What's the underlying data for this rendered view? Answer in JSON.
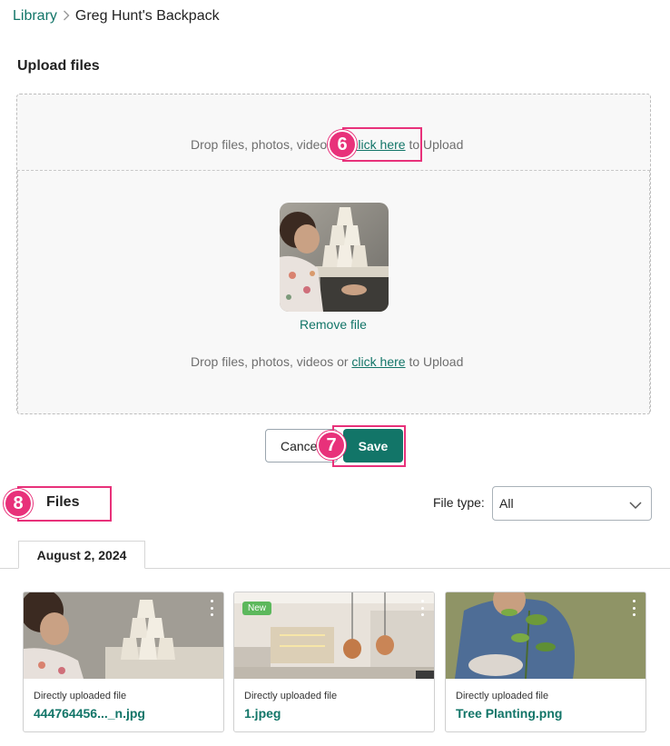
{
  "breadcrumb": {
    "root": "Library",
    "current": "Greg Hunt's Backpack"
  },
  "upload": {
    "title": "Upload files",
    "drop_prefix": "Drop files, photos, videos or ",
    "drop_link": "click here",
    "drop_suffix": " to Upload",
    "remove_file": "Remove file"
  },
  "actions": {
    "cancel": "Cancel",
    "save": "Save"
  },
  "annotations": {
    "step6": "6",
    "step7": "7",
    "step8": "8"
  },
  "files": {
    "title": "Files",
    "filter_label": "File type:",
    "filter_value": "All",
    "tabs": [
      {
        "label": "August 2, 2024"
      }
    ],
    "cards": [
      {
        "subtitle": "Directly uploaded file",
        "name": "444764456..._n.jpg",
        "badge": ""
      },
      {
        "subtitle": "Directly uploaded file",
        "name": "1.jpeg",
        "badge": "New"
      },
      {
        "subtitle": "Directly uploaded file",
        "name": "Tree Planting.png",
        "badge": ""
      }
    ]
  },
  "colors": {
    "accent": "#127568",
    "highlight": "#e8317a",
    "new_badge": "#5cb85c"
  }
}
